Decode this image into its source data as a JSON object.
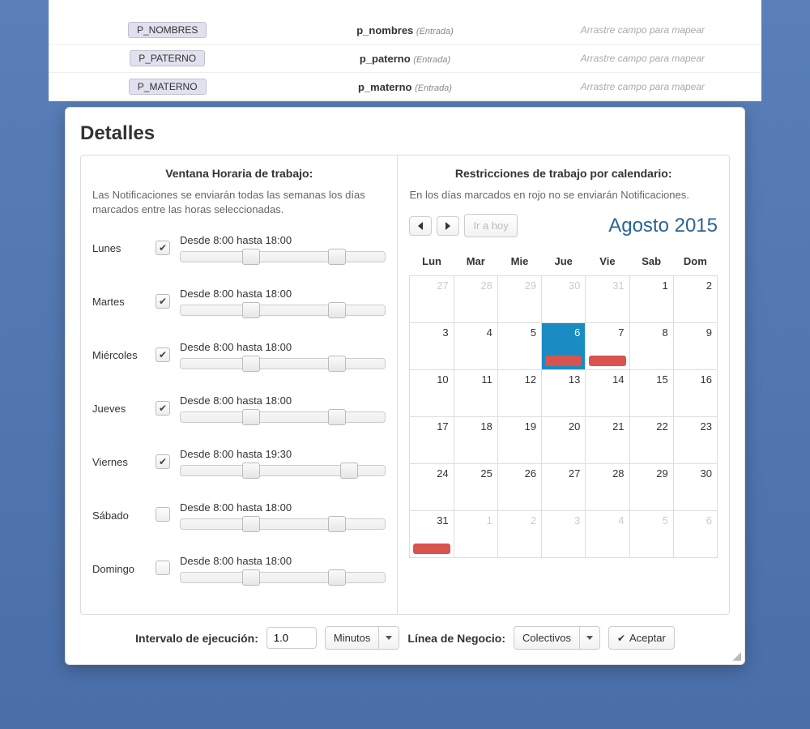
{
  "bg_rows": [
    {
      "badge": "P_NOMBRES",
      "mid": "p_nombres",
      "tag": "(Entrada)",
      "place": "Arrastre campo para mapear"
    },
    {
      "badge": "P_PATERNO",
      "mid": "p_paterno",
      "tag": "(Entrada)",
      "place": "Arrastre campo para mapear"
    },
    {
      "badge": "P_MATERNO",
      "mid": "p_materno",
      "tag": "(Entrada)",
      "place": "Arrastre campo para mapear"
    }
  ],
  "modal": {
    "title": "Detalles",
    "left_header": "Ventana Horaria de trabajo:",
    "left_desc": "Las Notificaciones se enviarán todas las semanas los días marcados entre las horas seleccionadas.",
    "right_header": "Restricciones de trabajo por calendario:",
    "right_desc": "En los días marcados en rojo no se enviarán Notificaciones.",
    "today_btn": "Ir a hoy",
    "cal_title": "Agosto 2015"
  },
  "days": [
    {
      "name": "Lunes",
      "checked": true,
      "range": "Desde 8:00 hasta 18:00",
      "h1": 30,
      "h2": 72
    },
    {
      "name": "Martes",
      "checked": true,
      "range": "Desde 8:00 hasta 18:00",
      "h1": 30,
      "h2": 72
    },
    {
      "name": "Miércoles",
      "checked": true,
      "range": "Desde 8:00 hasta 18:00",
      "h1": 30,
      "h2": 72
    },
    {
      "name": "Jueves",
      "checked": true,
      "range": "Desde 8:00 hasta 18:00",
      "h1": 30,
      "h2": 72
    },
    {
      "name": "Viernes",
      "checked": true,
      "range": "Desde 8:00 hasta 19:30",
      "h1": 30,
      "h2": 78
    },
    {
      "name": "Sábado",
      "checked": false,
      "range": "Desde 8:00 hasta 18:00",
      "h1": 30,
      "h2": 72
    },
    {
      "name": "Domingo",
      "checked": false,
      "range": "Desde 8:00 hasta 18:00",
      "h1": 30,
      "h2": 72
    }
  ],
  "weekdays": [
    "Lun",
    "Mar",
    "Mie",
    "Jue",
    "Vie",
    "Sab",
    "Dom"
  ],
  "calendar": [
    [
      {
        "n": 27,
        "m": true
      },
      {
        "n": 28,
        "m": true
      },
      {
        "n": 29,
        "m": true
      },
      {
        "n": 30,
        "m": true
      },
      {
        "n": 31,
        "m": true
      },
      {
        "n": 1
      },
      {
        "n": 2
      }
    ],
    [
      {
        "n": 3
      },
      {
        "n": 4
      },
      {
        "n": 5
      },
      {
        "n": 6,
        "sel": true,
        "ev": true
      },
      {
        "n": 7,
        "ev": true
      },
      {
        "n": 8
      },
      {
        "n": 9
      }
    ],
    [
      {
        "n": 10
      },
      {
        "n": 11
      },
      {
        "n": 12
      },
      {
        "n": 13
      },
      {
        "n": 14
      },
      {
        "n": 15
      },
      {
        "n": 16
      }
    ],
    [
      {
        "n": 17
      },
      {
        "n": 18
      },
      {
        "n": 19
      },
      {
        "n": 20
      },
      {
        "n": 21
      },
      {
        "n": 22
      },
      {
        "n": 23
      }
    ],
    [
      {
        "n": 24
      },
      {
        "n": 25
      },
      {
        "n": 26
      },
      {
        "n": 27
      },
      {
        "n": 28
      },
      {
        "n": 29
      },
      {
        "n": 30
      }
    ],
    [
      {
        "n": 31,
        "ev": true
      },
      {
        "n": 1,
        "m": true
      },
      {
        "n": 2,
        "m": true
      },
      {
        "n": 3,
        "m": true
      },
      {
        "n": 4,
        "m": true
      },
      {
        "n": 5,
        "m": true
      },
      {
        "n": 6,
        "m": true
      }
    ]
  ],
  "footer": {
    "interval_label": "Intervalo de ejecución:",
    "interval_value": "1.0",
    "unit": "Minutos",
    "lob_label": "Línea de Negocio:",
    "lob_value": "Colectivos",
    "accept": "Aceptar"
  }
}
